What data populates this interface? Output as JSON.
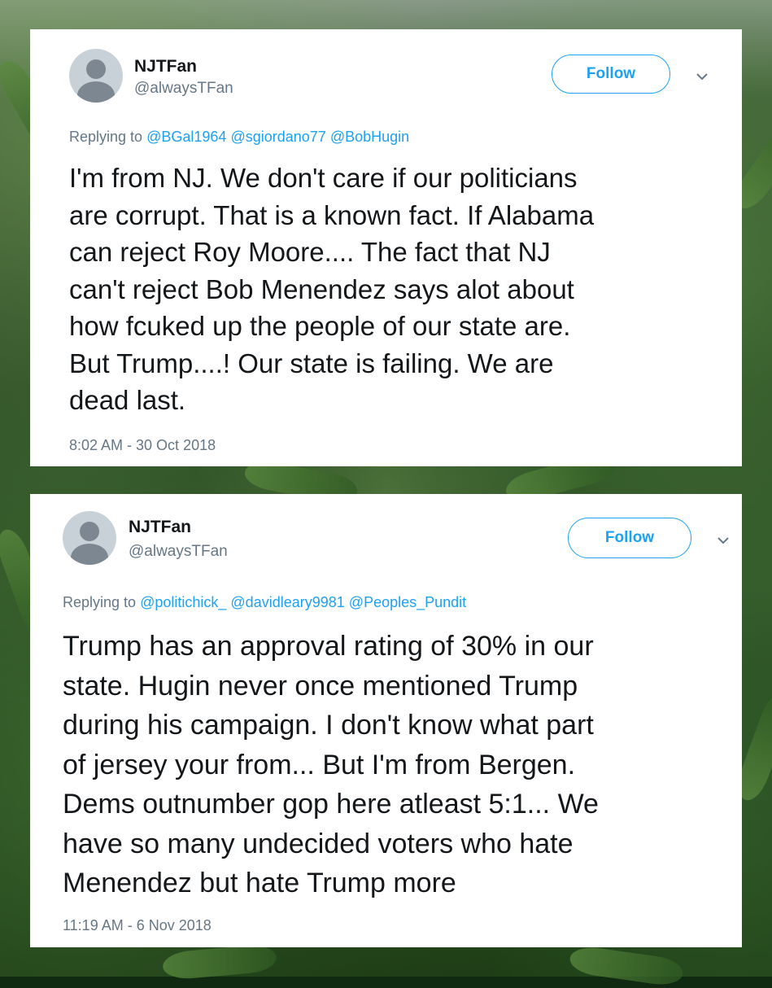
{
  "tweets": [
    {
      "display_name": "NJTFan",
      "handle": "@alwaysTFan",
      "follow_label": "Follow",
      "replying_prefix": "Replying to",
      "mentions": [
        "@BGal1964",
        "@sgiordano77",
        "@BobHugin"
      ],
      "text": "I'm from NJ. We don't care if our politicians\nare corrupt. That is a known fact. If Alabama\ncan reject Roy Moore.... The fact that NJ\ncan't reject Bob Menendez says alot about\nhow fcuked up the people of our state are.\nBut Trump....! Our state is failing. We are\ndead last.",
      "timestamp": "8:02 AM - 30 Oct 2018"
    },
    {
      "display_name": "NJTFan",
      "handle": "@alwaysTFan",
      "follow_label": "Follow",
      "replying_prefix": "Replying to",
      "mentions": [
        "@politichick_",
        "@davidleary9981",
        "@Peoples_Pundit"
      ],
      "text": "Trump has an approval rating of 30% in our\nstate. Hugin never once mentioned Trump\nduring his campaign. I don't know what part\nof jersey your from... But I'm from Bergen.\nDems outnumber gop here atleast 5:1... We\nhave so many undecided voters who hate\nMenendez but hate Trump more",
      "timestamp": "11:19 AM - 6 Nov 2018"
    }
  ],
  "icons": {
    "avatar": "default-avatar-icon",
    "more": "chevron-down-icon"
  },
  "colors": {
    "accent": "#1da1f2",
    "text": "#14171a",
    "secondary": "#657786"
  }
}
